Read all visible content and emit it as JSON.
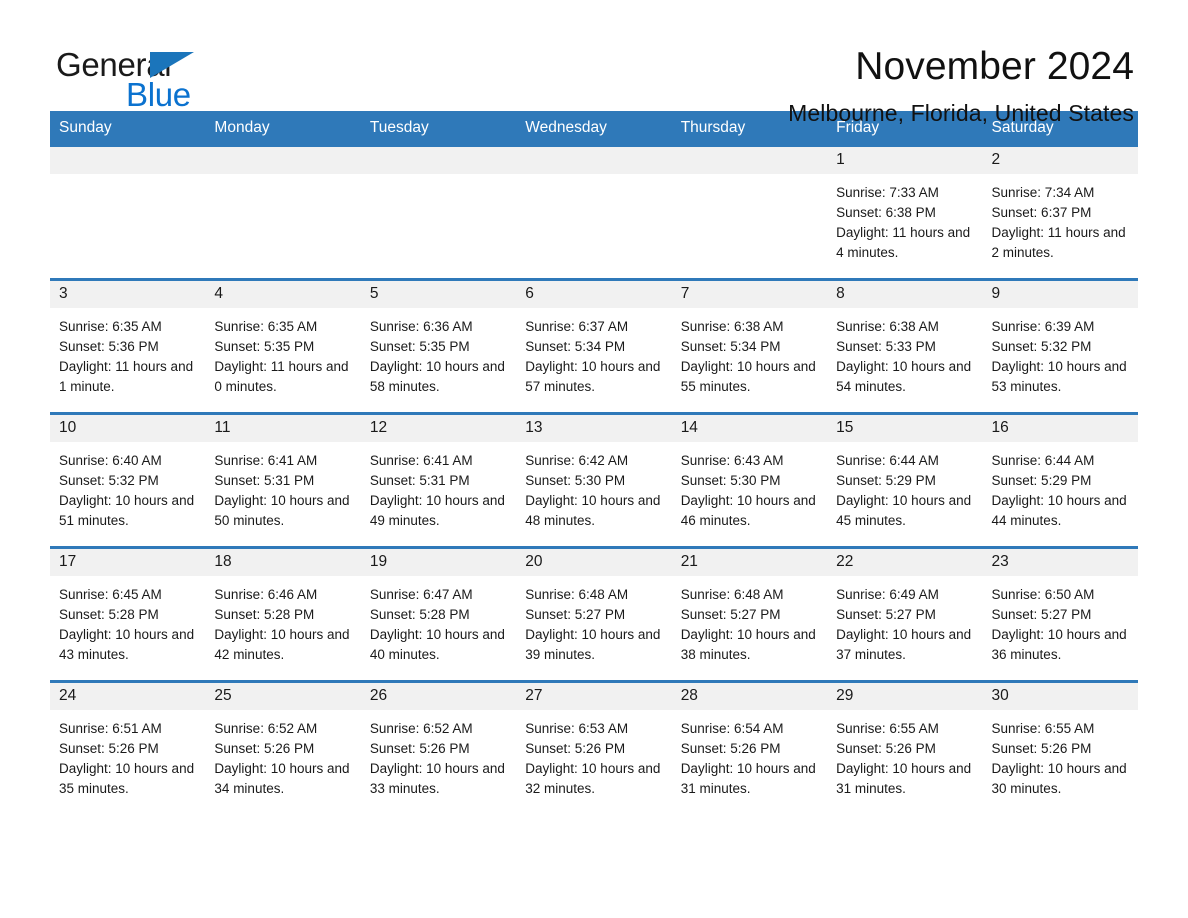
{
  "brand": {
    "name_part1": "General",
    "name_part2": "Blue",
    "triangle_color": "#1b75bb",
    "blue_color": "#0b72cf"
  },
  "header": {
    "title": "November 2024",
    "subtitle": "Melbourne, Florida, United States"
  },
  "theme": {
    "header_bg": "#2f79b9",
    "row_divider": "#2f79b9",
    "daynum_band": "#f1f1f1",
    "text": "#1a1a1a"
  },
  "weekdays": [
    "Sunday",
    "Monday",
    "Tuesday",
    "Wednesday",
    "Thursday",
    "Friday",
    "Saturday"
  ],
  "labels": {
    "sunrise_prefix": "Sunrise:",
    "sunset_prefix": "Sunset:",
    "daylight_prefix": "Daylight:"
  },
  "weeks": [
    [
      {
        "day": ""
      },
      {
        "day": ""
      },
      {
        "day": ""
      },
      {
        "day": ""
      },
      {
        "day": ""
      },
      {
        "day": "1",
        "sunrise": "Sunrise: 7:33 AM",
        "sunset": "Sunset: 6:38 PM",
        "daylight": "Daylight: 11 hours and 4 minutes."
      },
      {
        "day": "2",
        "sunrise": "Sunrise: 7:34 AM",
        "sunset": "Sunset: 6:37 PM",
        "daylight": "Daylight: 11 hours and 2 minutes."
      }
    ],
    [
      {
        "day": "3",
        "sunrise": "Sunrise: 6:35 AM",
        "sunset": "Sunset: 5:36 PM",
        "daylight": "Daylight: 11 hours and 1 minute."
      },
      {
        "day": "4",
        "sunrise": "Sunrise: 6:35 AM",
        "sunset": "Sunset: 5:35 PM",
        "daylight": "Daylight: 11 hours and 0 minutes."
      },
      {
        "day": "5",
        "sunrise": "Sunrise: 6:36 AM",
        "sunset": "Sunset: 5:35 PM",
        "daylight": "Daylight: 10 hours and 58 minutes."
      },
      {
        "day": "6",
        "sunrise": "Sunrise: 6:37 AM",
        "sunset": "Sunset: 5:34 PM",
        "daylight": "Daylight: 10 hours and 57 minutes."
      },
      {
        "day": "7",
        "sunrise": "Sunrise: 6:38 AM",
        "sunset": "Sunset: 5:34 PM",
        "daylight": "Daylight: 10 hours and 55 minutes."
      },
      {
        "day": "8",
        "sunrise": "Sunrise: 6:38 AM",
        "sunset": "Sunset: 5:33 PM",
        "daylight": "Daylight: 10 hours and 54 minutes."
      },
      {
        "day": "9",
        "sunrise": "Sunrise: 6:39 AM",
        "sunset": "Sunset: 5:32 PM",
        "daylight": "Daylight: 10 hours and 53 minutes."
      }
    ],
    [
      {
        "day": "10",
        "sunrise": "Sunrise: 6:40 AM",
        "sunset": "Sunset: 5:32 PM",
        "daylight": "Daylight: 10 hours and 51 minutes."
      },
      {
        "day": "11",
        "sunrise": "Sunrise: 6:41 AM",
        "sunset": "Sunset: 5:31 PM",
        "daylight": "Daylight: 10 hours and 50 minutes."
      },
      {
        "day": "12",
        "sunrise": "Sunrise: 6:41 AM",
        "sunset": "Sunset: 5:31 PM",
        "daylight": "Daylight: 10 hours and 49 minutes."
      },
      {
        "day": "13",
        "sunrise": "Sunrise: 6:42 AM",
        "sunset": "Sunset: 5:30 PM",
        "daylight": "Daylight: 10 hours and 48 minutes."
      },
      {
        "day": "14",
        "sunrise": "Sunrise: 6:43 AM",
        "sunset": "Sunset: 5:30 PM",
        "daylight": "Daylight: 10 hours and 46 minutes."
      },
      {
        "day": "15",
        "sunrise": "Sunrise: 6:44 AM",
        "sunset": "Sunset: 5:29 PM",
        "daylight": "Daylight: 10 hours and 45 minutes."
      },
      {
        "day": "16",
        "sunrise": "Sunrise: 6:44 AM",
        "sunset": "Sunset: 5:29 PM",
        "daylight": "Daylight: 10 hours and 44 minutes."
      }
    ],
    [
      {
        "day": "17",
        "sunrise": "Sunrise: 6:45 AM",
        "sunset": "Sunset: 5:28 PM",
        "daylight": "Daylight: 10 hours and 43 minutes."
      },
      {
        "day": "18",
        "sunrise": "Sunrise: 6:46 AM",
        "sunset": "Sunset: 5:28 PM",
        "daylight": "Daylight: 10 hours and 42 minutes."
      },
      {
        "day": "19",
        "sunrise": "Sunrise: 6:47 AM",
        "sunset": "Sunset: 5:28 PM",
        "daylight": "Daylight: 10 hours and 40 minutes."
      },
      {
        "day": "20",
        "sunrise": "Sunrise: 6:48 AM",
        "sunset": "Sunset: 5:27 PM",
        "daylight": "Daylight: 10 hours and 39 minutes."
      },
      {
        "day": "21",
        "sunrise": "Sunrise: 6:48 AM",
        "sunset": "Sunset: 5:27 PM",
        "daylight": "Daylight: 10 hours and 38 minutes."
      },
      {
        "day": "22",
        "sunrise": "Sunrise: 6:49 AM",
        "sunset": "Sunset: 5:27 PM",
        "daylight": "Daylight: 10 hours and 37 minutes."
      },
      {
        "day": "23",
        "sunrise": "Sunrise: 6:50 AM",
        "sunset": "Sunset: 5:27 PM",
        "daylight": "Daylight: 10 hours and 36 minutes."
      }
    ],
    [
      {
        "day": "24",
        "sunrise": "Sunrise: 6:51 AM",
        "sunset": "Sunset: 5:26 PM",
        "daylight": "Daylight: 10 hours and 35 minutes."
      },
      {
        "day": "25",
        "sunrise": "Sunrise: 6:52 AM",
        "sunset": "Sunset: 5:26 PM",
        "daylight": "Daylight: 10 hours and 34 minutes."
      },
      {
        "day": "26",
        "sunrise": "Sunrise: 6:52 AM",
        "sunset": "Sunset: 5:26 PM",
        "daylight": "Daylight: 10 hours and 33 minutes."
      },
      {
        "day": "27",
        "sunrise": "Sunrise: 6:53 AM",
        "sunset": "Sunset: 5:26 PM",
        "daylight": "Daylight: 10 hours and 32 minutes."
      },
      {
        "day": "28",
        "sunrise": "Sunrise: 6:54 AM",
        "sunset": "Sunset: 5:26 PM",
        "daylight": "Daylight: 10 hours and 31 minutes."
      },
      {
        "day": "29",
        "sunrise": "Sunrise: 6:55 AM",
        "sunset": "Sunset: 5:26 PM",
        "daylight": "Daylight: 10 hours and 31 minutes."
      },
      {
        "day": "30",
        "sunrise": "Sunrise: 6:55 AM",
        "sunset": "Sunset: 5:26 PM",
        "daylight": "Daylight: 10 hours and 30 minutes."
      }
    ]
  ]
}
